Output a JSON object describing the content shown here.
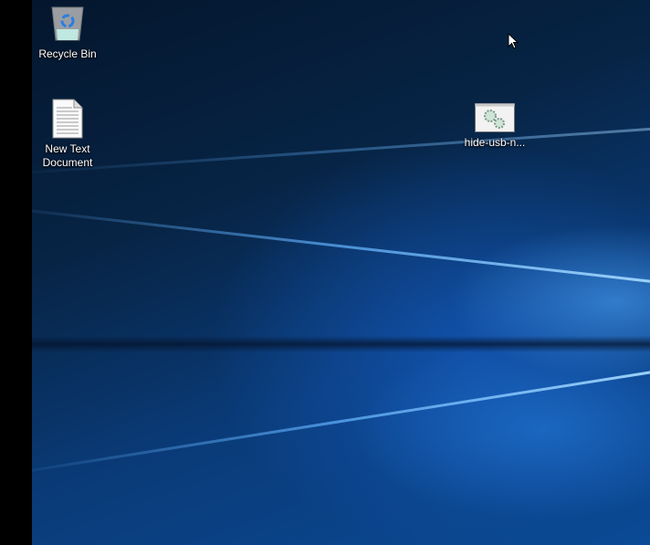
{
  "desktop_icons": [
    {
      "label": "Recycle Bin",
      "icon": "recycle-bin-icon"
    },
    {
      "label": "New Text Document",
      "icon": "text-document-icon"
    },
    {
      "label": "hide-usb-n...",
      "icon": "batch-file-gears-icon"
    }
  ],
  "colors": {
    "accent": "#0a5cc8",
    "left_strip": "#000000"
  }
}
